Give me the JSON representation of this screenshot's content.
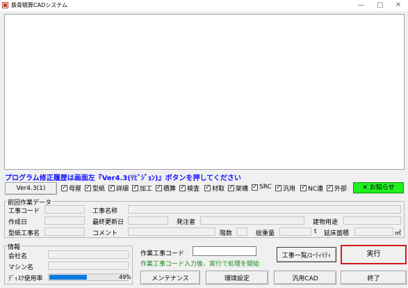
{
  "window": {
    "title": "鉄骨積算CADシステム",
    "minimize": "—",
    "maximize": "□",
    "close": "✕"
  },
  "notice_text": "プログラム修正履歴は画面左『Ver4.3(ﾘﾋﾞｼﾞｮﾝ)』ボタンを押してください",
  "version_button": "Ver4.3(1)",
  "checkboxes": [
    "母屋",
    "型紙",
    "詳細",
    "加工",
    "積算",
    "検査",
    "材取",
    "架構",
    "SRC",
    "汎用",
    "NC連",
    "外部"
  ],
  "notice_button": "✕ お知らせ",
  "previous_work": {
    "title": "前回作業データ",
    "labels": {
      "project_code": "工事コード",
      "project_name": "工事名称",
      "created": "作成日",
      "last_updated": "最終更新日",
      "client": "発注者",
      "building_use": "建物用途",
      "drawing_project": "型紙工事名",
      "comment": "コメント",
      "floors": "階数",
      "total_weight": "総重量",
      "weight_unit": "t",
      "floor_area": "延床面積",
      "area_unit": "㎡"
    }
  },
  "info": {
    "title": "情報",
    "company_label": "会社名",
    "machine_label": "マシン名",
    "disk_label": "ﾃﾞｨｽｸ使用率",
    "disk_usage_percent": 49,
    "disk_usage_text": "49%"
  },
  "work_code": {
    "label": "作業工事コード",
    "value": "",
    "hint": "作業工事コード入力後、実行で処理を開始"
  },
  "buttons": {
    "project_list": "工事一覧/ﾕｰﾃｨﾘﾃｨ",
    "execute": "実行",
    "maintenance": "メンテナンス",
    "environment": "環境設定",
    "general_cad": "汎用CAD",
    "exit": "終了"
  }
}
